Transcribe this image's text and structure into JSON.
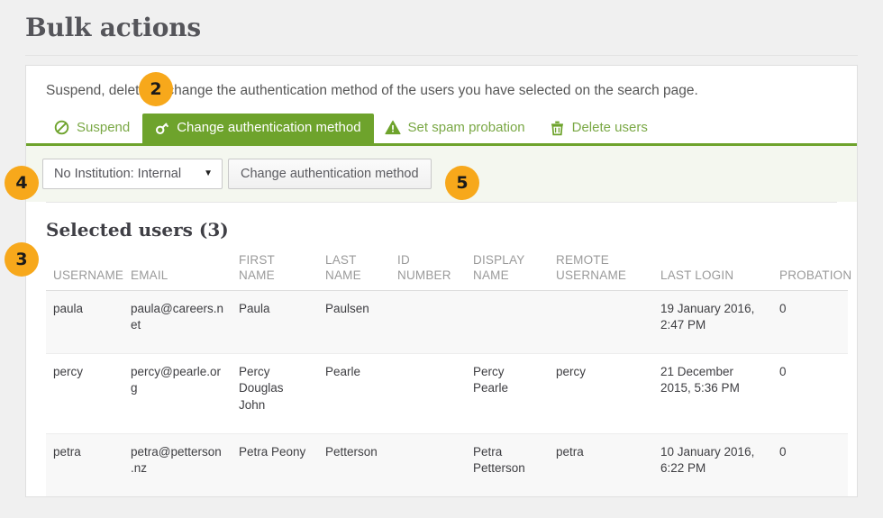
{
  "page": {
    "title": "Bulk actions",
    "intro": "Suspend, delete or change the authentication method of the users you have selected on the search page."
  },
  "tabs": [
    {
      "label": "Suspend",
      "icon": "ban-icon",
      "active": false
    },
    {
      "label": "Change authentication method",
      "icon": "key-icon",
      "active": true
    },
    {
      "label": "Set spam probation",
      "icon": "warning-triangle-icon",
      "active": false
    },
    {
      "label": "Delete users",
      "icon": "trash-icon",
      "active": false
    }
  ],
  "toolbar": {
    "institution_select_value": "No Institution: Internal",
    "institution_select_options": [
      "No Institution: Internal"
    ],
    "submit_label": "Change authentication method"
  },
  "selected_users": {
    "heading": "Selected users (3)",
    "columns": [
      "USERNAME",
      "EMAIL",
      "FIRST NAME",
      "LAST NAME",
      "ID NUMBER",
      "DISPLAY NAME",
      "REMOTE USERNAME",
      "LAST LOGIN",
      "PROBATION"
    ],
    "rows": [
      {
        "username": "paula",
        "email": "paula@careers.net",
        "first_name": "Paula",
        "last_name": "Paulsen",
        "id_number": "",
        "display_name": "",
        "remote_username": "",
        "last_login": "19 January 2016, 2:47 PM",
        "probation": "0"
      },
      {
        "username": "percy",
        "email": "percy@pearle.org",
        "first_name": "Percy Douglas John",
        "last_name": "Pearle",
        "id_number": "",
        "display_name": "Percy Pearle",
        "remote_username": "percy",
        "last_login": "21 December 2015, 5:36 PM",
        "probation": "0"
      },
      {
        "username": "petra",
        "email": "petra@petterson.nz",
        "first_name": "Petra Peony",
        "last_name": "Petterson",
        "id_number": "",
        "display_name": "Petra Petterson",
        "remote_username": "petra",
        "last_login": "10 January 2016, 6:22 PM",
        "probation": "0"
      }
    ]
  },
  "callouts": [
    {
      "number": "2"
    },
    {
      "number": "4"
    },
    {
      "number": "5"
    },
    {
      "number": "3"
    }
  ],
  "colors": {
    "accent_green": "#6ea32c",
    "tab_link_green": "#7aa845",
    "callout_orange": "#f7a81b",
    "toolbar_bg": "#f4f7ef",
    "page_bg": "#f0f0f0"
  }
}
